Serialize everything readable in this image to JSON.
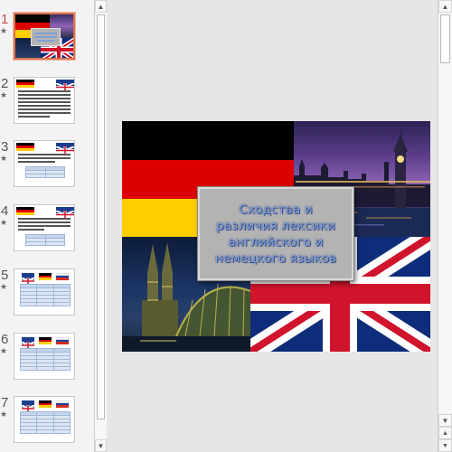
{
  "thumbnails": [
    {
      "number": "1",
      "starred": true,
      "active": true,
      "kind": "title"
    },
    {
      "number": "2",
      "starred": true,
      "active": false,
      "kind": "text"
    },
    {
      "number": "3",
      "starred": true,
      "active": false,
      "kind": "text-table"
    },
    {
      "number": "4",
      "starred": true,
      "active": false,
      "kind": "text-table"
    },
    {
      "number": "5",
      "starred": true,
      "active": false,
      "kind": "three-flags-table"
    },
    {
      "number": "6",
      "starred": true,
      "active": false,
      "kind": "three-flags-table"
    },
    {
      "number": "7",
      "starred": true,
      "active": false,
      "kind": "three-flags-table"
    }
  ],
  "star_glyph": "★",
  "slide": {
    "title": "Сходства и различия лексики английского и немецкого языков",
    "title_lines": [
      "Сходства и",
      "различия лексики",
      "английского и",
      "немецкого языков"
    ]
  },
  "icons": {
    "scroll_up": "up-arrow-icon",
    "scroll_down": "down-arrow-icon"
  },
  "colors": {
    "de_black": "#000000",
    "de_red": "#dd0000",
    "de_gold": "#ffce00",
    "uk_blue": "#0d2c7a",
    "uk_red": "#cf142b",
    "active_border": "#d9724f",
    "title_text": "#7f9fd4"
  }
}
